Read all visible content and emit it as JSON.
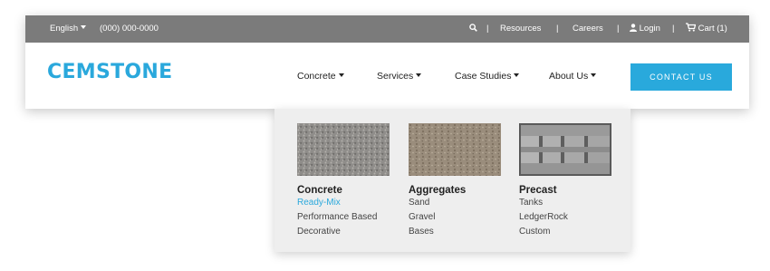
{
  "topbar": {
    "language": "English",
    "phone": "(000) 000-0000",
    "search_icon": "search-icon",
    "separator": "|",
    "resources": "Resources",
    "careers": "Careers",
    "login": "Login",
    "cart": "Cart (1)"
  },
  "brand": {
    "logo_text": "CEMSTONE",
    "accent": "#2aa8dc"
  },
  "nav": {
    "items": [
      {
        "label": "Concrete"
      },
      {
        "label": "Services"
      },
      {
        "label": "Case Studies"
      },
      {
        "label": "About Us"
      }
    ],
    "cta": "CONTACT US"
  },
  "dropdown": {
    "columns": [
      {
        "title": "Concrete",
        "image": "gravel-texture",
        "links": [
          "Ready-Mix",
          "Performance Based",
          "Decorative"
        ],
        "active_link": "Ready-Mix"
      },
      {
        "title": "Aggregates",
        "image": "dirt-texture",
        "links": [
          "Sand",
          "Gravel",
          "Bases"
        ]
      },
      {
        "title": "Precast",
        "image": "precast-blocks",
        "links": [
          "Tanks",
          "LedgerRock",
          "Custom"
        ]
      }
    ]
  }
}
